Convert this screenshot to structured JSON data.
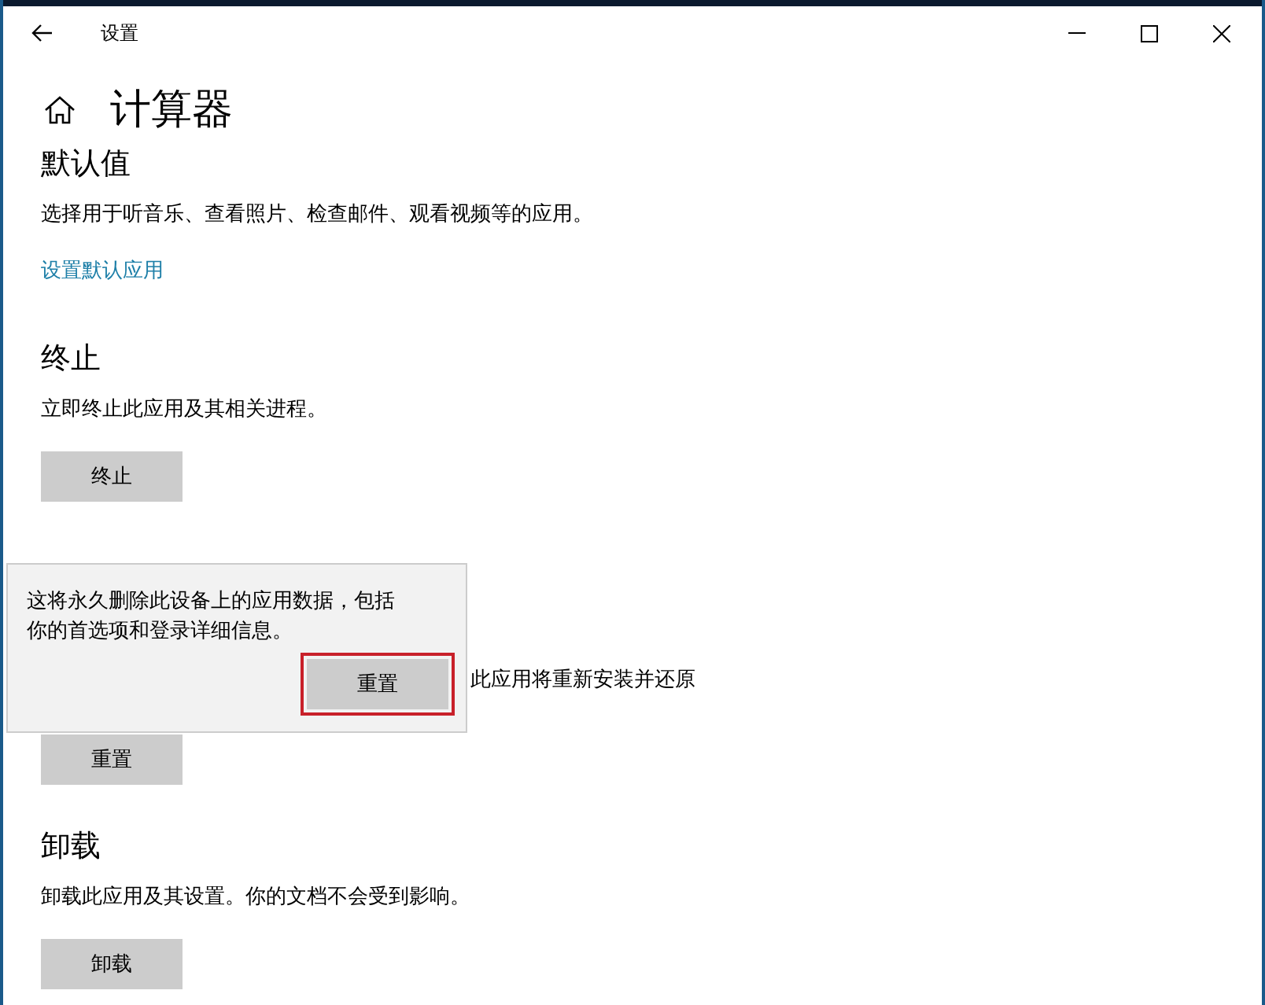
{
  "window": {
    "title": "设置"
  },
  "page": {
    "title": "计算器"
  },
  "sections": [
    {
      "kind": "link",
      "title": "默认值",
      "description": "选择用于听音乐、查看照片、检查邮件、观看视频等的应用。",
      "link": "设置默认应用"
    },
    {
      "kind": "button",
      "title": "终止",
      "description": "立即终止此应用及其相关进程。",
      "button": "终止"
    },
    {
      "kind": "covered",
      "description": "此应用将重新安装并还原",
      "button": "重置"
    },
    {
      "kind": "button",
      "title": "卸载",
      "description": "卸载此应用及其设置。你的文档不会受到影响。",
      "button": "卸载"
    }
  ],
  "flyout": {
    "message": "这将永久删除此设备上的应用数据，包括你的首选项和登录详细信息。",
    "button": "重置",
    "highlighted": true
  }
}
